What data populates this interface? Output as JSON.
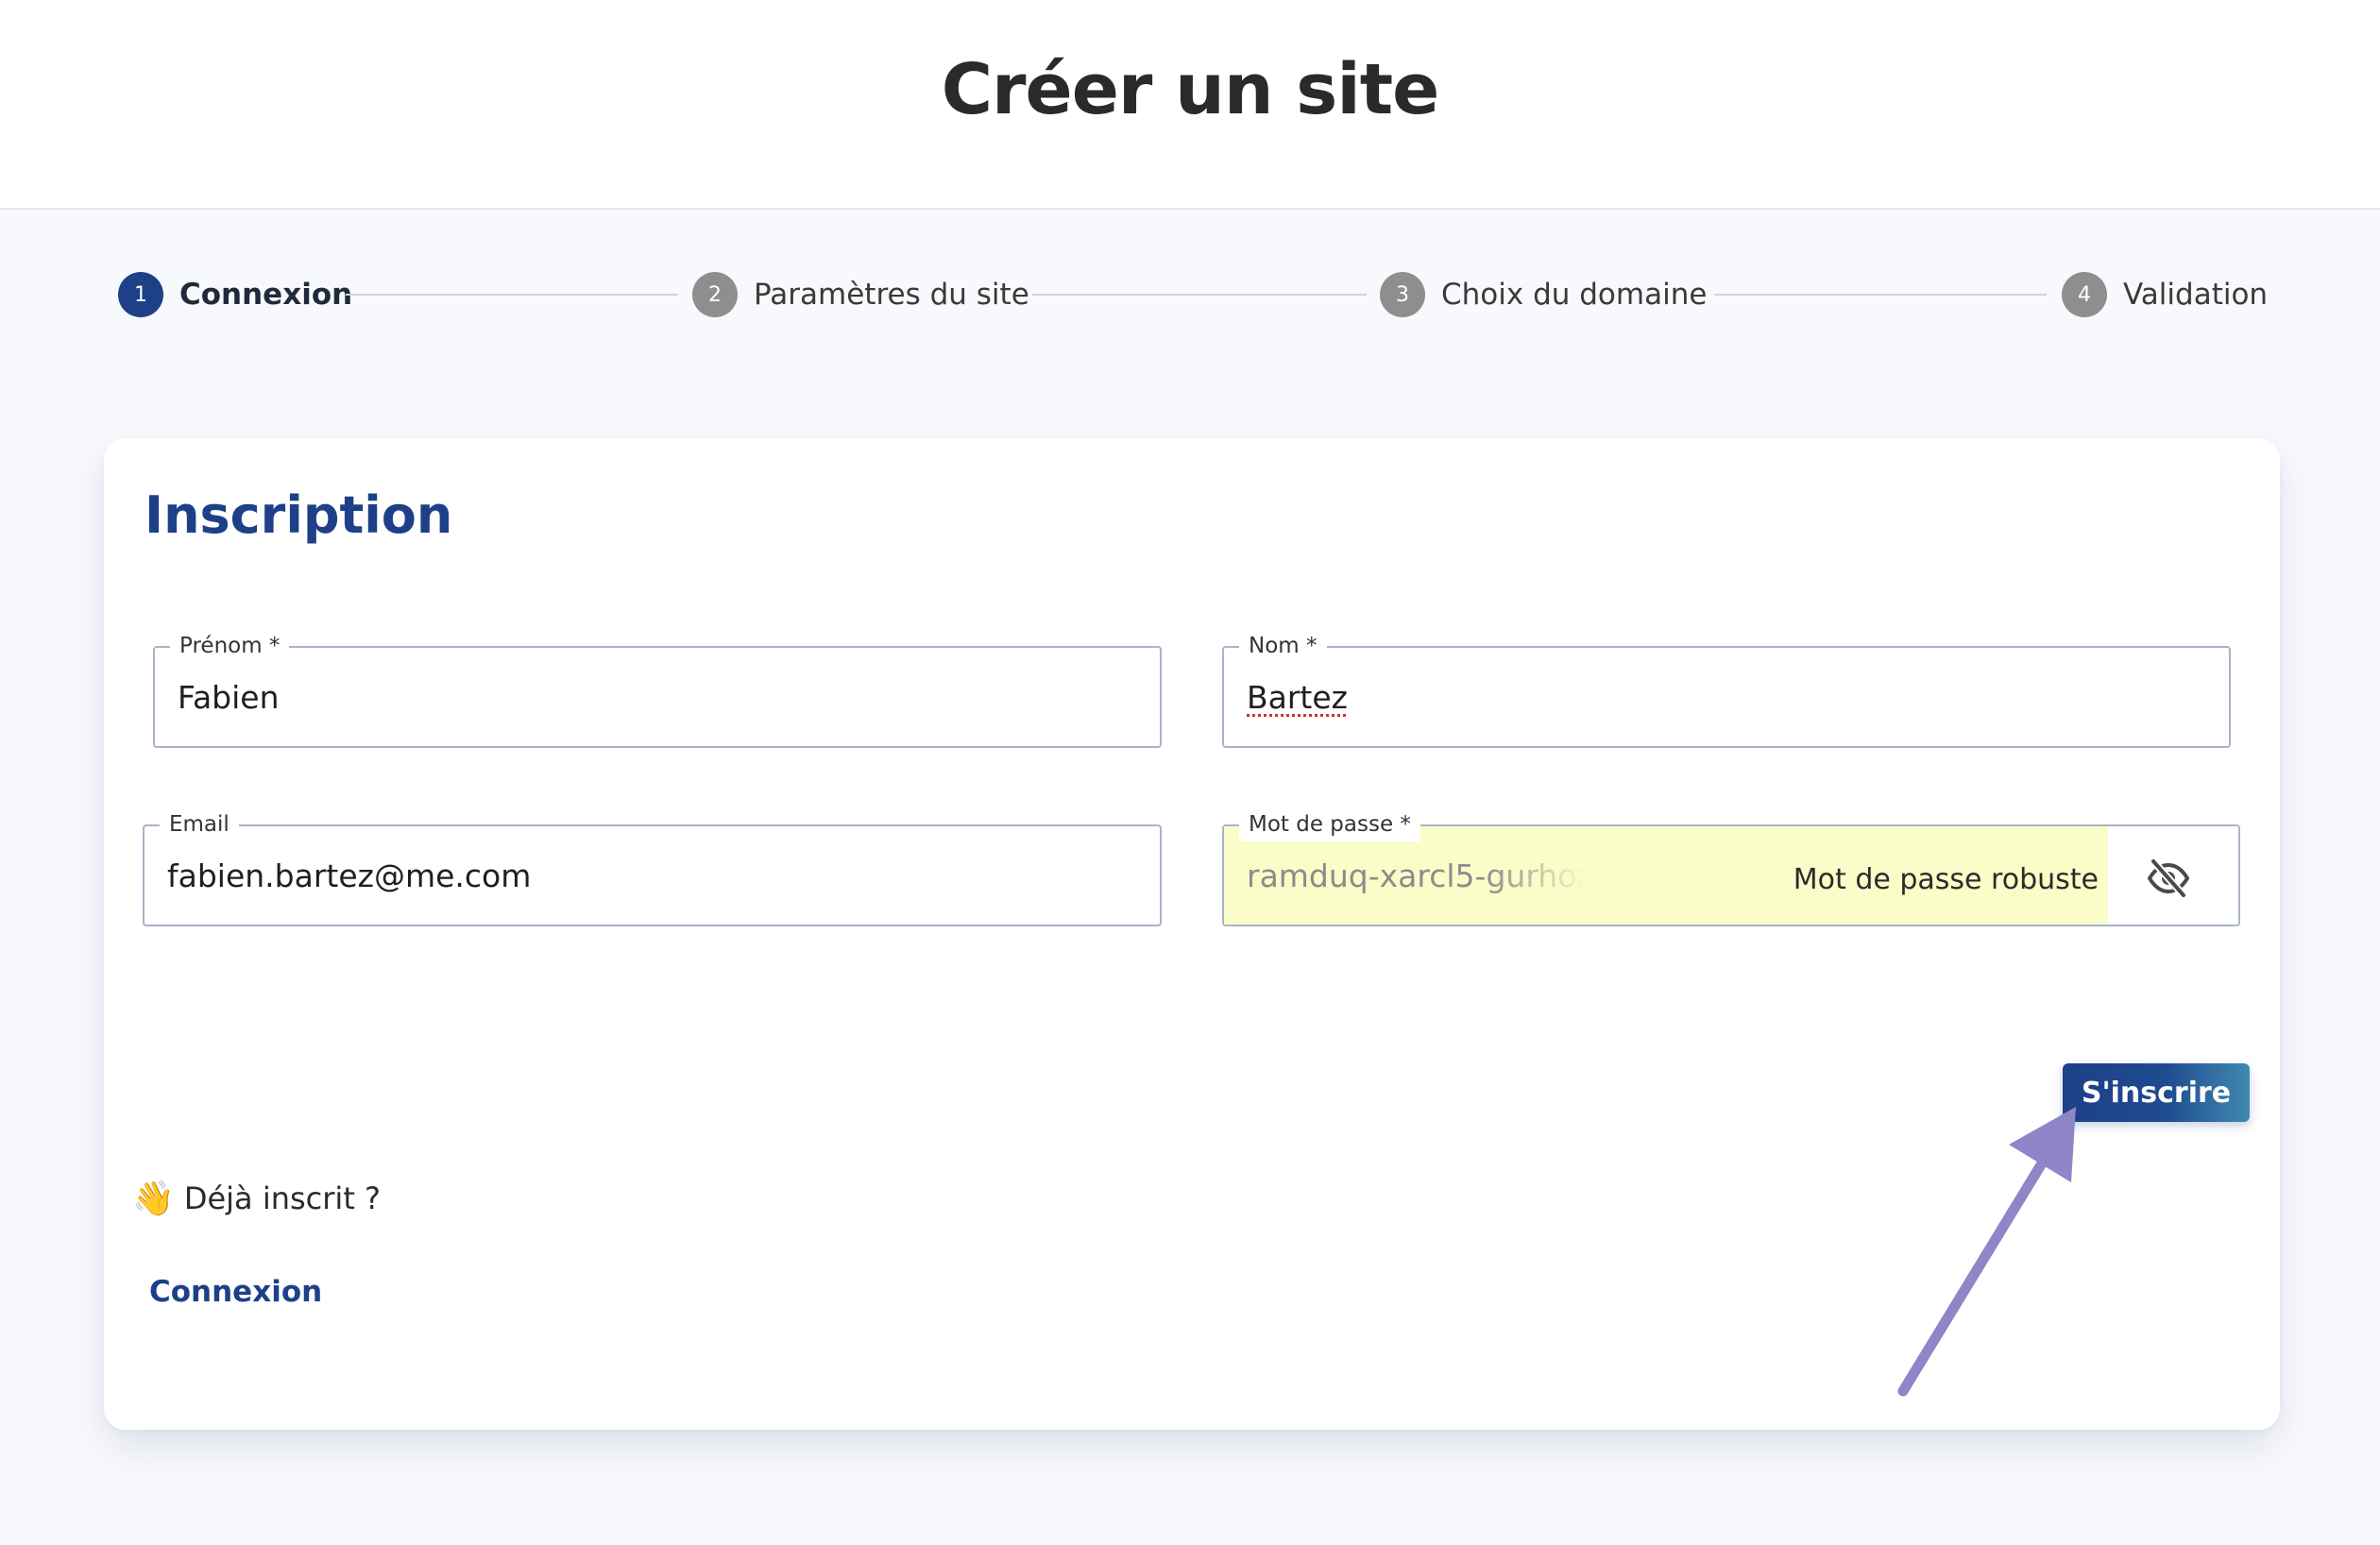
{
  "header": {
    "title": "Créer un site"
  },
  "stepper": {
    "steps": [
      {
        "number": "1",
        "label": "Connexion",
        "state": "active"
      },
      {
        "number": "2",
        "label": "Paramètres du site",
        "state": "inactive"
      },
      {
        "number": "3",
        "label": "Choix du domaine",
        "state": "inactive"
      },
      {
        "number": "4",
        "label": "Validation",
        "state": "inactive"
      }
    ]
  },
  "form": {
    "title": "Inscription",
    "first_name": {
      "label": "Prénom *",
      "value": "Fabien"
    },
    "last_name": {
      "label": "Nom *",
      "value": "Bartez"
    },
    "email": {
      "label": "Email",
      "value": "fabien.bartez@me.com"
    },
    "password": {
      "label": "Mot de passe *",
      "value": "ramduq-xarcl5-gurhoz",
      "strength_hint": "Mot de passe robuste"
    },
    "submit_label": "S'inscrire"
  },
  "login": {
    "prompt_emoji": "👋",
    "prompt": "Déjà inscrit ?",
    "link_label": "Connexion"
  },
  "colors": {
    "primary": "#1d4088",
    "autofill_highlight": "#fbfdc9",
    "annotation_arrow": "#8f85c7"
  },
  "icons": {
    "password_toggle": "eye-slash-icon",
    "wave": "waving-hand-icon"
  }
}
